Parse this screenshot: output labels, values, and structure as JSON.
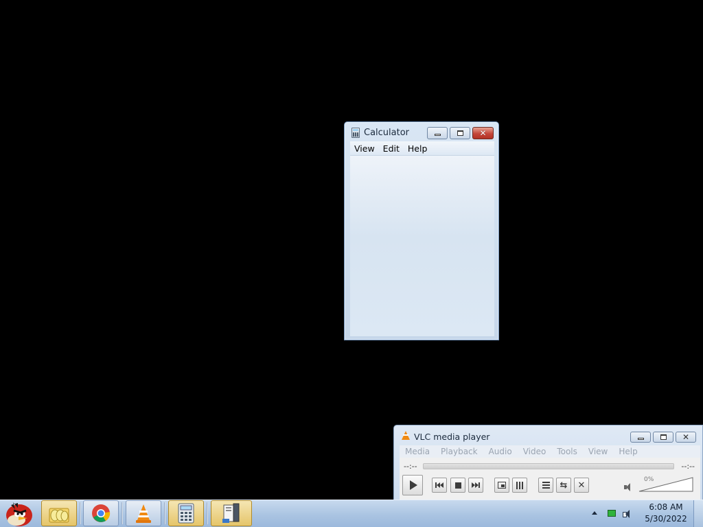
{
  "calculator": {
    "title": "Calculator",
    "menu": [
      "View",
      "Edit",
      "Help"
    ]
  },
  "vlc": {
    "title": "VLC media player",
    "menu": [
      "Media",
      "Playback",
      "Audio",
      "Video",
      "Tools",
      "View",
      "Help"
    ],
    "time_elapsed": "--:--",
    "time_total": "--:--",
    "volume_label": "0%",
    "volume_level": 0
  },
  "taskbar": {
    "apps": [
      {
        "icon": "angry-bird-icon",
        "name": "Angry Birds"
      },
      {
        "icon": "eggs-folder-icon",
        "name": "Folder"
      },
      {
        "icon": "chrome-icon",
        "name": "Google Chrome"
      },
      {
        "icon": "vlc-icon",
        "name": "VLC media player"
      },
      {
        "icon": "calculator-icon",
        "name": "Calculator",
        "active": true
      },
      {
        "icon": "file-manager-icon",
        "name": "File manager"
      }
    ],
    "clock": {
      "time": "6:08 AM",
      "date": "5/30/2022"
    }
  },
  "colors": {
    "desktop": "#000000",
    "taskbar": "#aac4e2",
    "window_frame": "#cddcee",
    "close_button": "#c4473a",
    "vlc_orange": "#f08a12"
  }
}
